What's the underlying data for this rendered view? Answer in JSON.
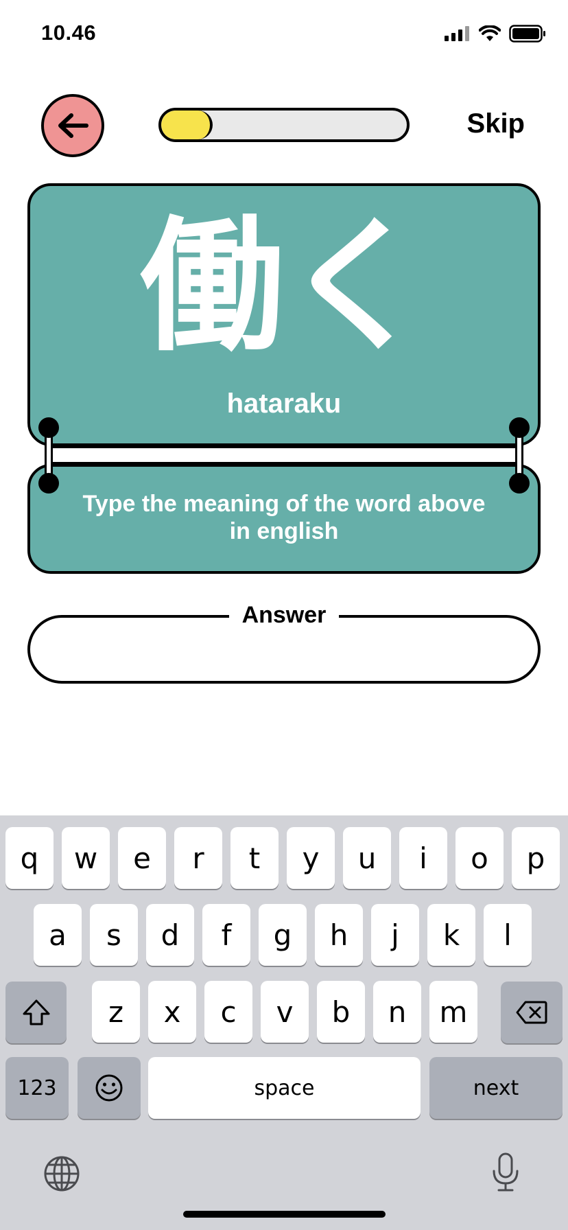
{
  "status_bar": {
    "time": "10.46"
  },
  "header": {
    "skip_label": "Skip",
    "progress": 0.21,
    "progress_color": "#f7e34c",
    "back_color": "#ef9494"
  },
  "card": {
    "word": "働く",
    "reading": "hataraku",
    "instruction_line1": "Type the meaning of the word above",
    "instruction_line2": "in english",
    "color": "#66afa9"
  },
  "answer": {
    "label": "Answer",
    "value": "",
    "placeholder": ""
  },
  "keyboard": {
    "row1": [
      "q",
      "w",
      "e",
      "r",
      "t",
      "y",
      "u",
      "i",
      "o",
      "p"
    ],
    "row2": [
      "a",
      "s",
      "d",
      "f",
      "g",
      "h",
      "j",
      "k",
      "l"
    ],
    "row3": [
      "z",
      "x",
      "c",
      "v",
      "b",
      "n",
      "m"
    ],
    "numbers_label": "123",
    "space_label": "space",
    "next_label": "next"
  }
}
